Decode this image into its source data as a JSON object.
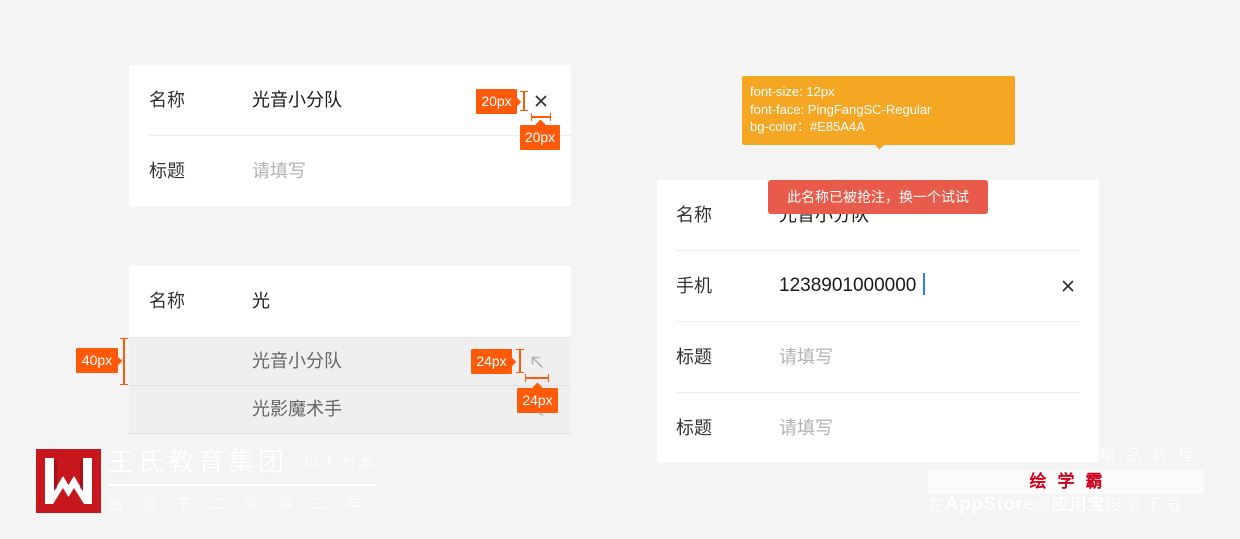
{
  "colors": {
    "page_background": "#f4f4f4",
    "card_background": "#ffffff",
    "annotation": "#ff5a0a",
    "tooltip_background": "#f5a623",
    "error_toast_background": "#e85a4a",
    "caret": "#2f7cf6",
    "logo_red": "#c8161d",
    "brand_red": "#d0021b"
  },
  "clear_field_card": {
    "name_row": {
      "label": "名称",
      "value": "光音小分队",
      "clear_icon": "close-icon"
    },
    "title_row": {
      "label": "标题",
      "placeholder": "请填写"
    }
  },
  "autocomplete_card": {
    "name_row": {
      "label": "名称",
      "value": "光"
    },
    "suggestions": [
      {
        "text": "光音小分队",
        "icon": "arrow-up-left-icon"
      },
      {
        "text": "光影魔术手",
        "icon": "arrow-up-left-icon"
      }
    ]
  },
  "spec_labels": [
    "20px",
    "20px",
    "40px",
    "24px",
    "24px"
  ],
  "toast_spec_tooltip": {
    "lines": [
      "font-size: 12px",
      "font-face: PingFangSC-Regular",
      "bg-color：#E85A4A"
    ]
  },
  "validation_card": {
    "error_toast": "此名称已被抢注，换一个试试",
    "rows": [
      {
        "label": "名称",
        "value": "光音小分队"
      },
      {
        "label": "手机",
        "value": "1238901000000",
        "clear_icon": "close-icon"
      },
      {
        "label": "标题",
        "placeholder": "请填写"
      },
      {
        "label": "标题",
        "placeholder": "请填写"
      }
    ]
  },
  "watermark_left": {
    "logo_icon": "wangshi-logo-icon",
    "name": "王氏教育集团",
    "motto": "以人为本",
    "founded": "始创于二零零二年"
  },
  "watermark_right": {
    "tagline": "精品教程",
    "brand": "绘学霸",
    "download_prefix": "在",
    "download_store": "AppStore",
    "download_or": "或",
    "download_app": "应用宝",
    "download_suffix": "搜索下载"
  }
}
